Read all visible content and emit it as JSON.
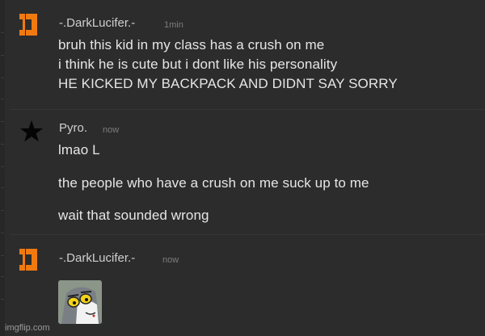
{
  "messages": [
    {
      "username": "-.DarkLucifer.-",
      "timestamp": "1min",
      "lines": [
        "bruh this kid in my class has a crush on me",
        "i think he is cute but i dont like his personality",
        "HE KICKED MY BACKPACK AND DIDNT SAY SORRY"
      ],
      "avatar_icon": "orange-bracket-logo-icon"
    },
    {
      "username": "Pyro.",
      "timestamp": "now",
      "lines": [
        "lmao L",
        "the people who have a crush on me suck up to me",
        "wait that sounded wrong"
      ],
      "avatar_icon": "black-star-icon"
    },
    {
      "username": "-.DarkLucifer.-",
      "timestamp": "now",
      "attachment": "cartoon-cat-face-image",
      "avatar_icon": "orange-bracket-logo-icon"
    }
  ],
  "colors": {
    "background": "#2c2c2c",
    "avatar_orange": "#f07a10",
    "username": "#cfcfcf",
    "timestamp": "#7d7d7d"
  },
  "watermark": "imgflip.com"
}
